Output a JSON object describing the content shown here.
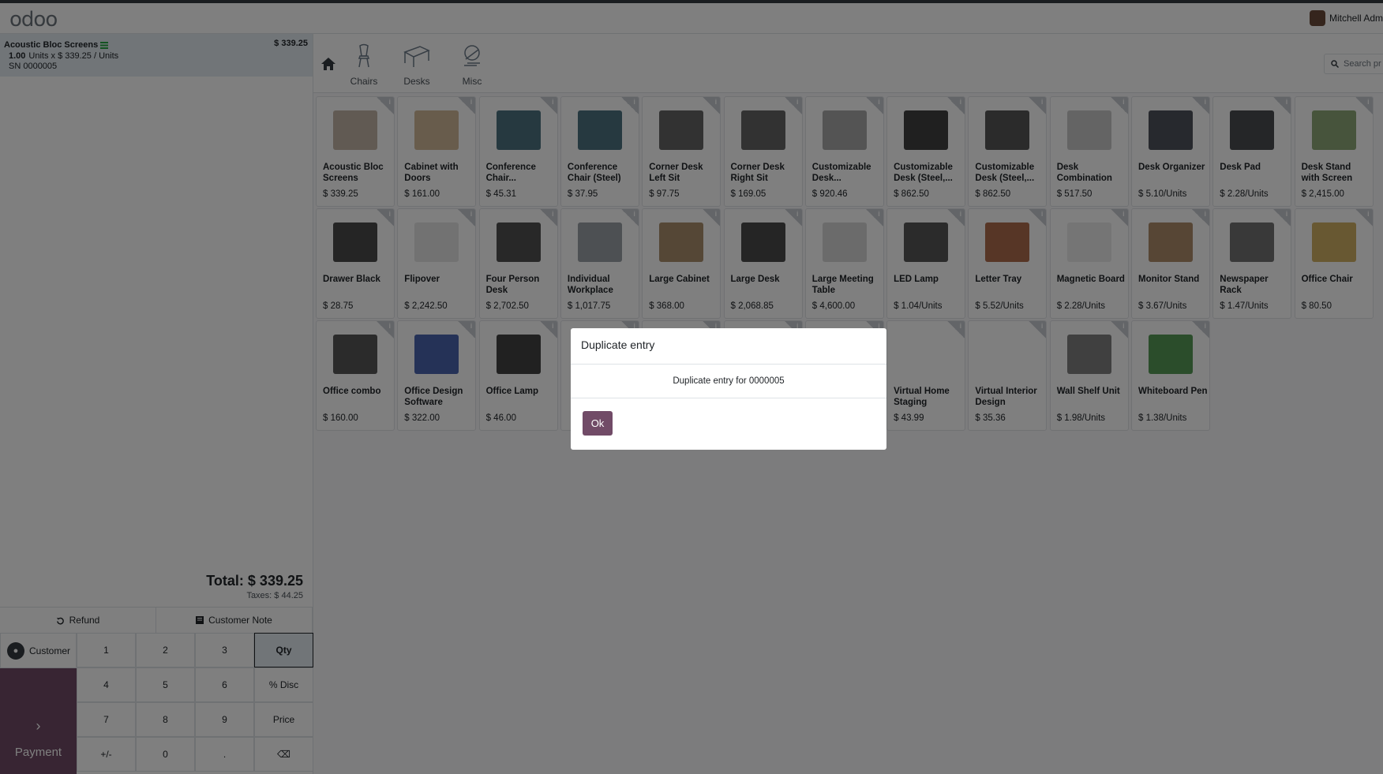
{
  "header": {
    "logo": "odoo",
    "user_name": "Mitchell Adm"
  },
  "order": {
    "lines": [
      {
        "name": "Acoustic Bloc Screens",
        "price": "$ 339.25",
        "qty": "1.00",
        "unit_text": "Units x $ 339.25 / Units",
        "serial": "SN 0000005"
      }
    ],
    "total": "Total: $ 339.25",
    "taxes": "Taxes: $ 44.25"
  },
  "actions": {
    "refund": "Refund",
    "customer_note": "Customer Note"
  },
  "pad": {
    "customer": "Customer",
    "payment": "Payment",
    "keys": [
      "1",
      "2",
      "3",
      "Qty",
      "4",
      "5",
      "6",
      "% Disc",
      "7",
      "8",
      "9",
      "Price",
      "+/-",
      "0",
      ".",
      "⌫"
    ]
  },
  "categories": [
    {
      "label": "Chairs",
      "icon": "chair-icon"
    },
    {
      "label": "Desks",
      "icon": "desk-icon"
    },
    {
      "label": "Misc",
      "icon": "misc-icon"
    }
  ],
  "search": {
    "placeholder": "Search pr"
  },
  "products": [
    {
      "name": "Acoustic Bloc Screens",
      "price": "$ 339.25",
      "color": "#b8a898"
    },
    {
      "name": "Cabinet with Doors",
      "price": "$ 161.00",
      "color": "#c9ad86"
    },
    {
      "name": "Conference Chair...",
      "price": "$ 45.31",
      "color": "#2d5a6b"
    },
    {
      "name": "Conference Chair (Steel)",
      "price": "$ 37.95",
      "color": "#2d5a6b"
    },
    {
      "name": "Corner Desk Left Sit",
      "price": "$ 97.75",
      "color": "#4a4a4a"
    },
    {
      "name": "Corner Desk Right Sit",
      "price": "$ 169.05",
      "color": "#4a4a4a"
    },
    {
      "name": "Customizable Desk...",
      "price": "$ 920.46",
      "color": "#9a9a9a"
    },
    {
      "name": "Customizable Desk (Steel,...",
      "price": "$ 862.50",
      "color": "#1f1f1f"
    },
    {
      "name": "Customizable Desk (Steel,...",
      "price": "$ 862.50",
      "color": "#3a3a3a"
    },
    {
      "name": "Desk Combination",
      "price": "$ 517.50",
      "color": "#c0c0c0"
    },
    {
      "name": "Desk Organizer",
      "price": "$ 5.10/Units",
      "color": "#2f3440"
    },
    {
      "name": "Desk Pad",
      "price": "$ 2.28/Units",
      "color": "#2a2d33"
    },
    {
      "name": "Desk Stand with Screen",
      "price": "$ 2,415.00",
      "color": "#7a9a60"
    },
    {
      "name": "Drawer Black",
      "price": "$ 28.75",
      "color": "#2a2a2a"
    },
    {
      "name": "Flipover",
      "price": "$ 2,242.50",
      "color": "#e0e0e0"
    },
    {
      "name": "Four Person Desk",
      "price": "$ 2,702.50",
      "color": "#333333"
    },
    {
      "name": "Individual Workplace",
      "price": "$ 1,017.75",
      "color": "#8a8f96"
    },
    {
      "name": "Large Cabinet",
      "price": "$ 368.00",
      "color": "#9c7a52"
    },
    {
      "name": "Large Desk",
      "price": "$ 2,068.85",
      "color": "#2c2c2c"
    },
    {
      "name": "Large Meeting Table",
      "price": "$ 4,600.00",
      "color": "#d0d0d0"
    },
    {
      "name": "LED Lamp",
      "price": "$ 1.04/Units",
      "color": "#3a3a3a"
    },
    {
      "name": "Letter Tray",
      "price": "$ 5.52/Units",
      "color": "#a0522d"
    },
    {
      "name": "Magnetic Board",
      "price": "$ 2.28/Units",
      "color": "#e8e8e8"
    },
    {
      "name": "Monitor Stand",
      "price": "$ 3.67/Units",
      "color": "#a07850"
    },
    {
      "name": "Newspaper Rack",
      "price": "$ 1.47/Units",
      "color": "#5a5a5a"
    },
    {
      "name": "Office Chair",
      "price": "$ 80.50",
      "color": "#c9a24a"
    },
    {
      "name": "Office combo",
      "price": "$ 160.00",
      "color": "#3a3a3a"
    },
    {
      "name": "Office Design Software",
      "price": "$ 322.00",
      "color": "#2a4aa0"
    },
    {
      "name": "Office Lamp",
      "price": "$ 46.00",
      "color": "#222222"
    },
    {
      "name": "",
      "price": "",
      "color": "#ffffff"
    },
    {
      "name": "",
      "price": "",
      "color": "#ffffff"
    },
    {
      "name": "",
      "price": "",
      "color": "#ffffff"
    },
    {
      "name": "",
      "price": "",
      "color": "#ffffff"
    },
    {
      "name": "Virtual Home Staging",
      "price": "$ 43.99",
      "color": "#ffffff"
    },
    {
      "name": "Virtual Interior Design",
      "price": "$ 35.36",
      "color": "#ffffff"
    },
    {
      "name": "Wall Shelf Unit",
      "price": "$ 1.98/Units",
      "color": "#6a6a6a"
    },
    {
      "name": "Whiteboard Pen",
      "price": "$ 1.38/Units",
      "color": "#3a8a3a"
    }
  ],
  "dialog": {
    "title": "Duplicate entry",
    "message": "Duplicate entry for 0000005",
    "ok": "Ok"
  },
  "colors": {
    "brand": "#714b67",
    "selected_line": "#e2eaf1"
  }
}
